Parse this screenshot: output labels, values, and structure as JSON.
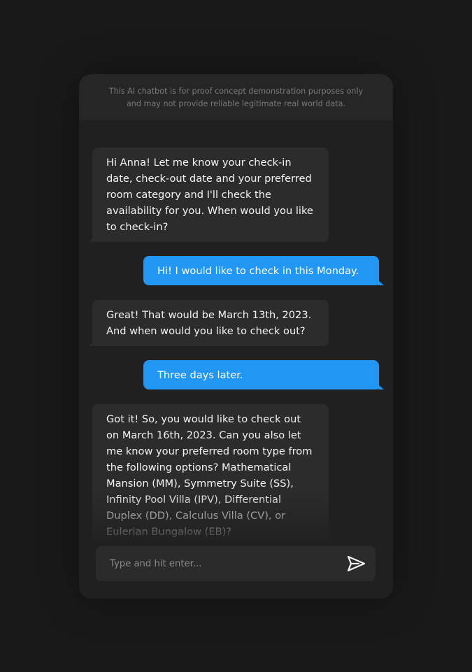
{
  "disclaimer": {
    "line1": "This AI chatbot is for proof concept demonstration purposes only",
    "line2": "and may not provide reliable legitimate real world data."
  },
  "messages": [
    {
      "sender": "bot",
      "text": "Hi Anna! Let me know your check-in date, check-out date and your preferred room category and I'll check the availability for you. When would you like to check-in?"
    },
    {
      "sender": "user",
      "text": "Hi! I would like to check in this Monday."
    },
    {
      "sender": "bot",
      "text": "Great! That would be March 13th, 2023. And when would you like to check out?"
    },
    {
      "sender": "user",
      "text": "Three days later."
    },
    {
      "sender": "bot",
      "text": "Got it! So, you would like to check out on March 16th, 2023. Can you also let me know your preferred room type from the following options? Mathematical Mansion (MM), Symmetry Suite (SS), Infinity Pool Villa (IPV), Differential Duplex (DD), Calculus Villa (CV), or Eulerian Bungalow (EB)?"
    }
  ],
  "composer": {
    "placeholder": "Type and hit enter...",
    "value": "",
    "send_icon": "send-icon"
  },
  "colors": {
    "page_background": "#191919",
    "window_background": "#202020",
    "bot_bubble": "#2c2c2c",
    "user_bubble": "#2196f3"
  }
}
